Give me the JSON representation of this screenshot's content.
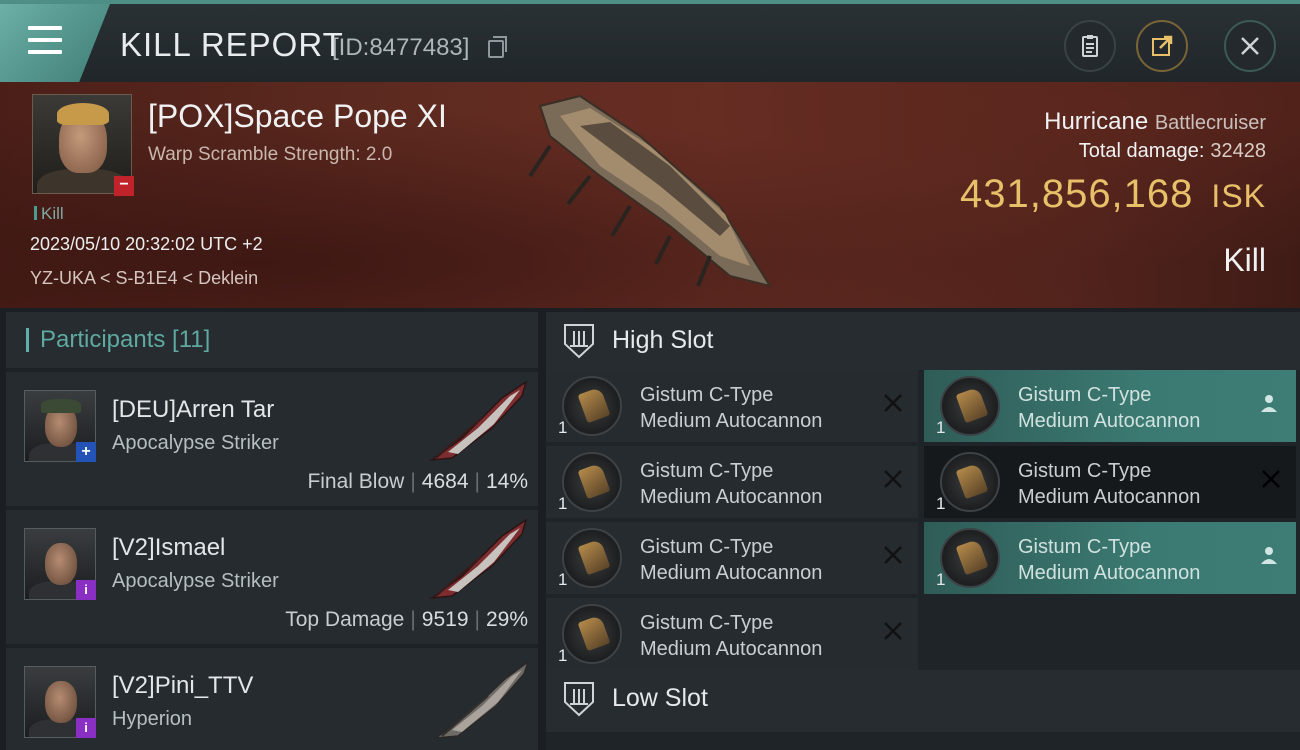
{
  "header": {
    "title": "KILL REPORT",
    "report_id": "[ID:8477483]"
  },
  "victim": {
    "name": "[POX]Space Pope XI",
    "scramble": "Warp Scramble Strength: 2.0",
    "kill_tag": "Kill",
    "timestamp": "2023/05/10 20:32:02 UTC +2",
    "location": "YZ-UKA < S-B1E4 < Deklein",
    "ship_name": "Hurricane",
    "ship_class": "Battlecruiser",
    "total_damage_label": "Total damage:",
    "total_damage": "32428",
    "isk_value": "431,856,168",
    "isk_unit": "ISK",
    "result": "Kill",
    "badge": "−"
  },
  "participants": {
    "label": "Participants [11]",
    "rows": [
      {
        "name": "[DEU]Arren Tar",
        "ship": "Apocalypse Striker",
        "role": "Final Blow",
        "damage": "4684",
        "percent": "14%",
        "badge": "+"
      },
      {
        "name": "[V2]Ismael",
        "ship": "Apocalypse Striker",
        "role": "Top Damage",
        "damage": "9519",
        "percent": "29%",
        "badge": "i"
      },
      {
        "name": "[V2]Pini_TTV",
        "ship": "Hyperion",
        "role": "",
        "damage": "",
        "percent": "",
        "badge": "i"
      }
    ]
  },
  "fitting": {
    "high_slot_title": "High Slot",
    "low_slot_title": "Low Slot",
    "module_line1": "Gistum C-Type",
    "module_line2": "Medium Autocannon",
    "quantity": "1"
  },
  "colors": {
    "accent": "#5fb2a8",
    "isk": "#e9c06a",
    "banner": "#5d2a20",
    "corp_blue": "#2453b8",
    "corp_purple": "#8a2fc4"
  },
  "icons": [
    "menu-icon",
    "copy-icon",
    "clipboard-icon",
    "share-icon",
    "close-icon",
    "slot-icon",
    "x-icon",
    "person-icon"
  ]
}
